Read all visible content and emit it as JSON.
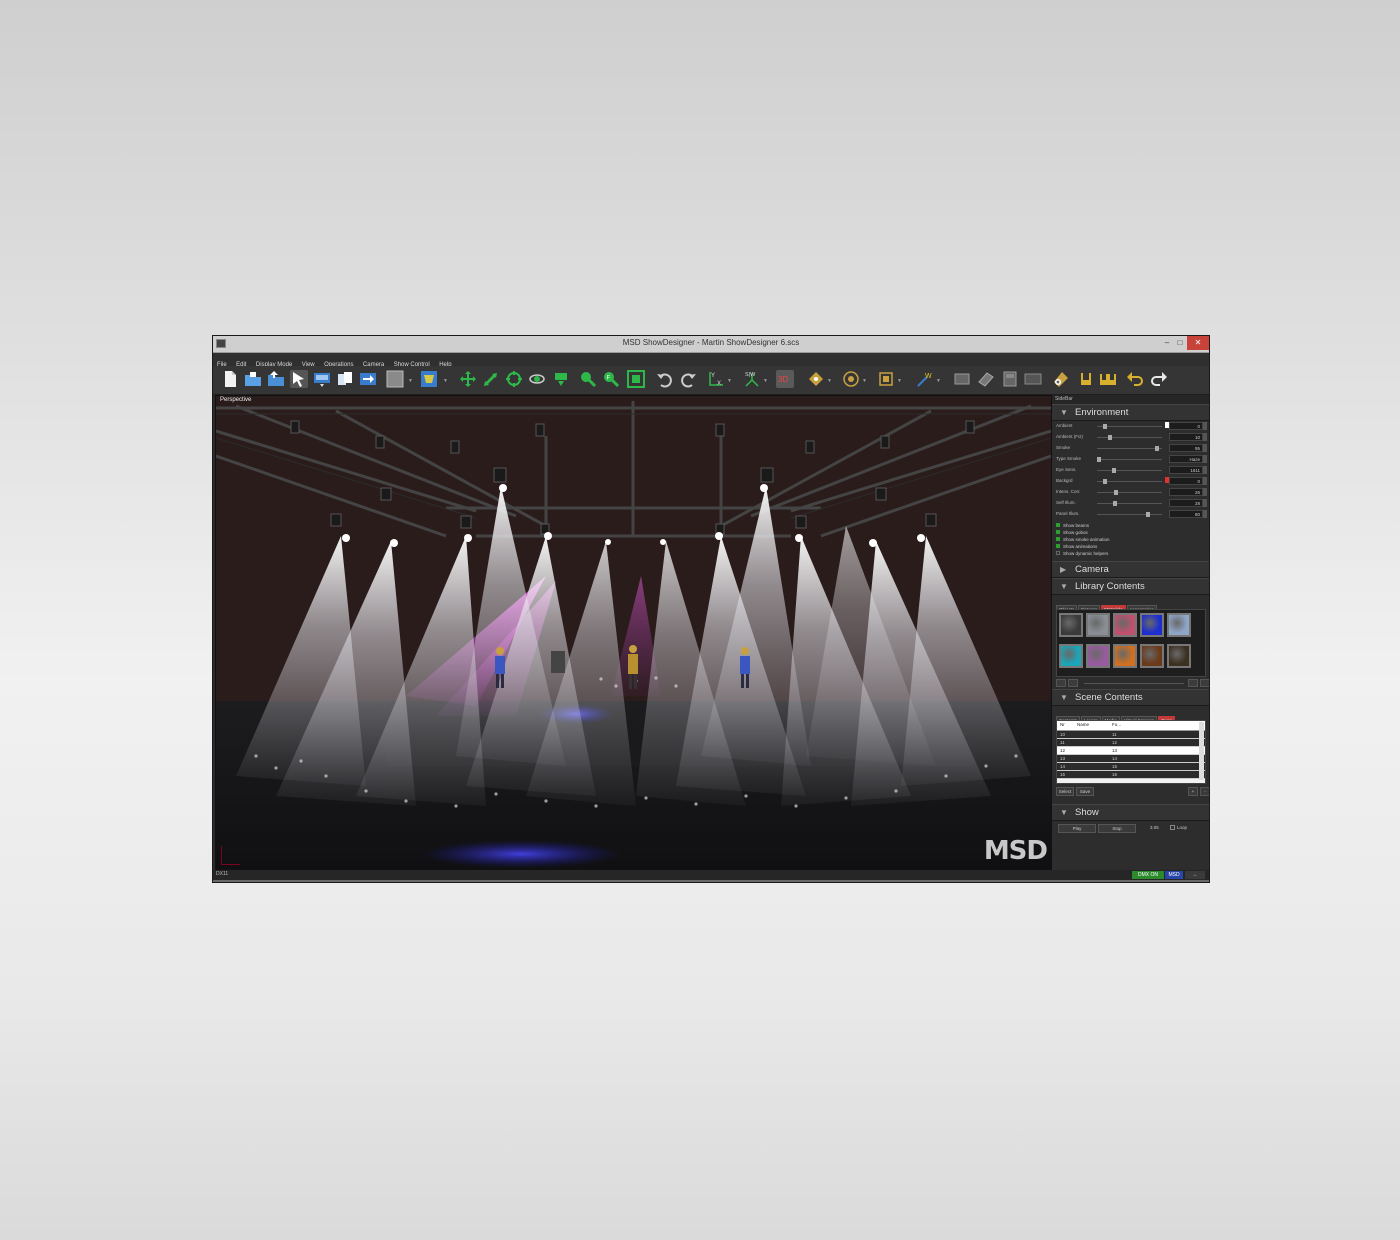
{
  "window": {
    "title": "MSD ShowDesigner - Martin ShowDesigner 6.scs",
    "min_glyph": "–",
    "max_glyph": "□",
    "close_glyph": "✕"
  },
  "menu": [
    "File",
    "Edit",
    "Display Mode",
    "View",
    "Operations",
    "Camera",
    "Show Control",
    "Help"
  ],
  "toolbar": {
    "icons": [
      "new-file-icon",
      "open-folder-icon",
      "save-icon",
      "select-arrow-icon",
      "fixture-icon",
      "copy-icon",
      "export-icon",
      "grey-square-icon",
      "stage-icon",
      "move-icon",
      "resize-icon",
      "rotate-icon",
      "orbit-icon",
      "pan-icon",
      "zoom-icon",
      "zoom-fit-icon",
      "zoom-extents-icon",
      "undo-view-icon",
      "redo-view-icon",
      "axis-yx-icon",
      "axis-sw-icon",
      "3d-view-icon",
      "camera-pos-icon",
      "target-icon",
      "camera-frame-icon",
      "wand-icon",
      "plane-icon",
      "tilt-plane-icon",
      "box-icon",
      "floor-icon",
      "add-fixture-icon",
      "group-icon",
      "group-multi-icon",
      "undo-icon",
      "redo-icon"
    ],
    "labels": {
      "axis_y": "Y",
      "axis_x": "X",
      "axis_sw": "S|W",
      "view_3d": "3D",
      "wand": "W",
      "zoom": "F"
    }
  },
  "viewport": {
    "label": "Perspective",
    "logo": "MSD"
  },
  "sidebar": {
    "title": "SideBar",
    "environment": {
      "heading": "Environment",
      "rows": [
        {
          "label": "Ambient",
          "value": "0",
          "knob": 0.1
        },
        {
          "label": "Ambient (Fct)",
          "value": "10",
          "knob": 0.18
        },
        {
          "label": "Smoke",
          "value": "95",
          "knob": 0.95
        },
        {
          "label": "Type Smoke",
          "value": "Haze",
          "knob": 0.0
        },
        {
          "label": "Eye Sens.",
          "value": "1611",
          "knob": 0.25
        },
        {
          "label": "Backgrd",
          "value": "0",
          "knob": 0.1
        },
        {
          "label": "Intens. Corr.",
          "value": "26",
          "knob": 0.28
        },
        {
          "label": "Self Illum.",
          "value": "28",
          "knob": 0.26
        },
        {
          "label": "Panel Illum.",
          "value": "80",
          "knob": 0.8
        }
      ],
      "checks": [
        {
          "label": "Show beams",
          "on": true
        },
        {
          "label": "Show gobos",
          "on": true
        },
        {
          "label": "Show smoke animation",
          "on": true
        },
        {
          "label": "Show animations",
          "on": true
        },
        {
          "label": "Show dynamic helpers",
          "on": false
        }
      ]
    },
    "camera": {
      "heading": "Camera"
    },
    "library": {
      "heading": "Library Contents",
      "tabs": [
        "Objects",
        "Fixtures",
        "Materials",
        "Accessories"
      ],
      "active_tab": "Materials",
      "thumb_colors": [
        "#3a3a3a",
        "#8a8f96",
        "#c0506e",
        "#1c2ed0",
        "#8ea6c8",
        "#1aa6b8",
        "#9a5aa0",
        "#d07020",
        "#6a3a1a",
        "#3c3020"
      ]
    },
    "scene": {
      "heading": "Scene Contents",
      "tabs": [
        "Contents",
        "Layers",
        "Media",
        "Virtual Screens",
        "Cues"
      ],
      "active_tab": "Cues",
      "columns": [
        "Nr",
        "Name",
        "Fo..."
      ],
      "rows": [
        {
          "nr": "10",
          "fo": "11"
        },
        {
          "nr": "11",
          "fo": "12"
        },
        {
          "nr": "12",
          "fo": "13",
          "selected": true
        },
        {
          "nr": "13",
          "fo": "14"
        },
        {
          "nr": "14",
          "fo": "15"
        },
        {
          "nr": "15",
          "fo": "16"
        }
      ],
      "select_label": "Select",
      "save_label": "Save",
      "plus": "+",
      "minus": "-"
    },
    "show": {
      "heading": "Show",
      "play_label": "Play",
      "stop_label": "Stop",
      "time": "3.05",
      "loop_label": "Loop"
    }
  },
  "status": {
    "left": "DX11",
    "dmx": "DMX ON",
    "msd": "MSD",
    "net": "↔"
  }
}
